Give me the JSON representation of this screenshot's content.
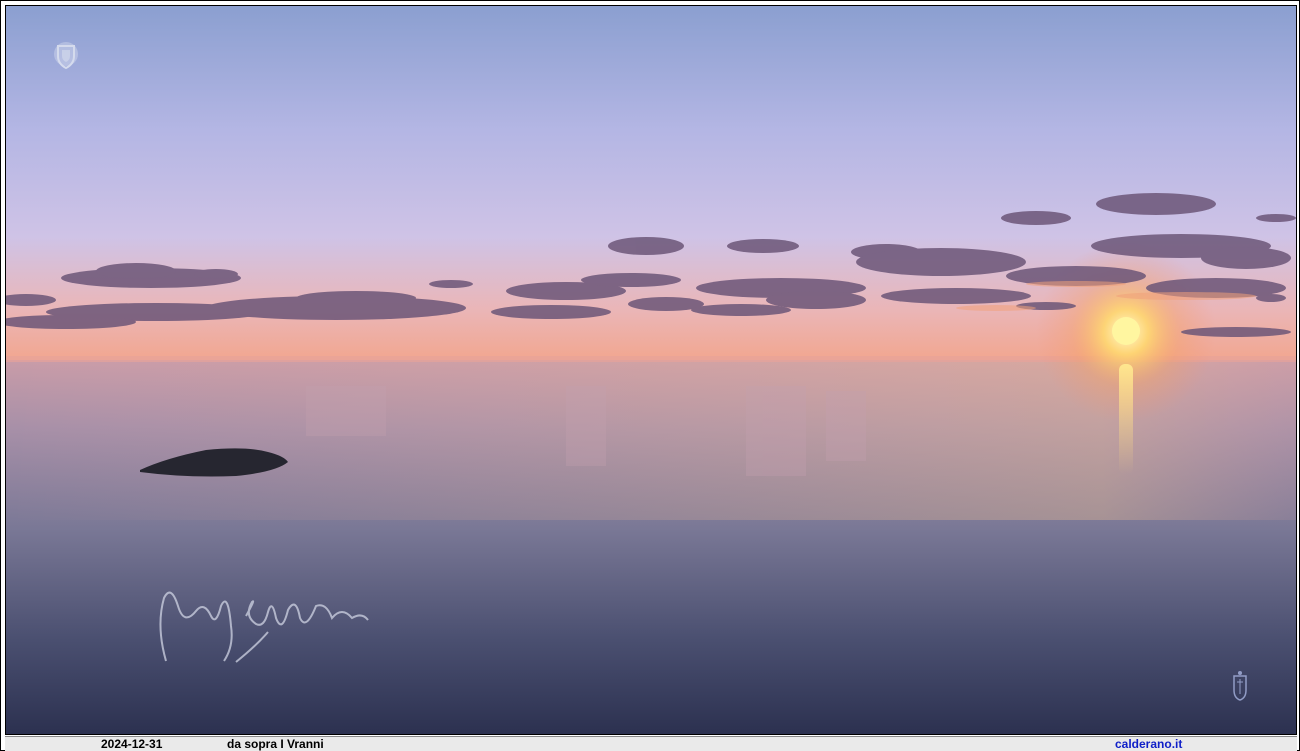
{
  "photo": {
    "subject": "sunset over calm sea",
    "colors": {
      "sky_top": "#8ea0d0",
      "sky_mid": "#c6c4ea",
      "horizon_glow": "#f4a68c",
      "sun": "#fff6a0",
      "sea_top": "#c89aa4",
      "sea_bottom": "#2e3352",
      "cloud": "#6e5878",
      "rock": "#262630"
    },
    "logo_icon": "crest-icon",
    "watermark_icon": "crest-icon",
    "signature": "signature-mark"
  },
  "caption": {
    "date": "2024-12-31",
    "location": "da sopra I Vranni",
    "site": "calderano.it"
  }
}
